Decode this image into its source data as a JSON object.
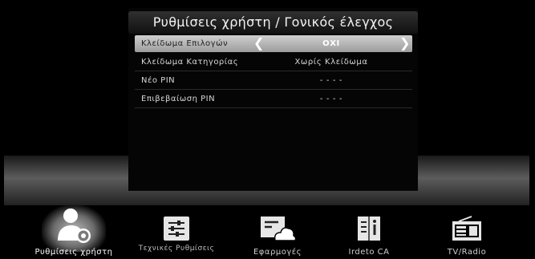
{
  "panel": {
    "title": "Ρυθμίσεις χρήστη / Γονικός έλεγχος"
  },
  "settings": [
    {
      "label": "Κλείδωμα Επιλογών",
      "value": "ΟΧΙ",
      "selected": true
    },
    {
      "label": "Κλείδωμα Κατηγορίας",
      "value": "Χωρίς Κλείδωμα",
      "selected": false
    },
    {
      "label": "Νέο PIN",
      "value": "- - - -",
      "selected": false
    },
    {
      "label": "Επιβεβαίωση PIN",
      "value": "- - - -",
      "selected": false
    }
  ],
  "arrows": {
    "left": "❮",
    "right": "❯"
  },
  "dock": [
    {
      "label": "Ρυθμίσεις χρήστη",
      "icon": "user-settings-icon",
      "active": true
    },
    {
      "label": "Τεχνικές Ρυθμίσεις",
      "icon": "sliders-icon",
      "active": false
    },
    {
      "label": "Εφαρμογές",
      "icon": "apps-cloud-icon",
      "active": false
    },
    {
      "label": "Irdeto CA",
      "icon": "info-book-icon",
      "active": false
    },
    {
      "label": "TV/Radio",
      "icon": "radio-icon",
      "active": false
    }
  ]
}
